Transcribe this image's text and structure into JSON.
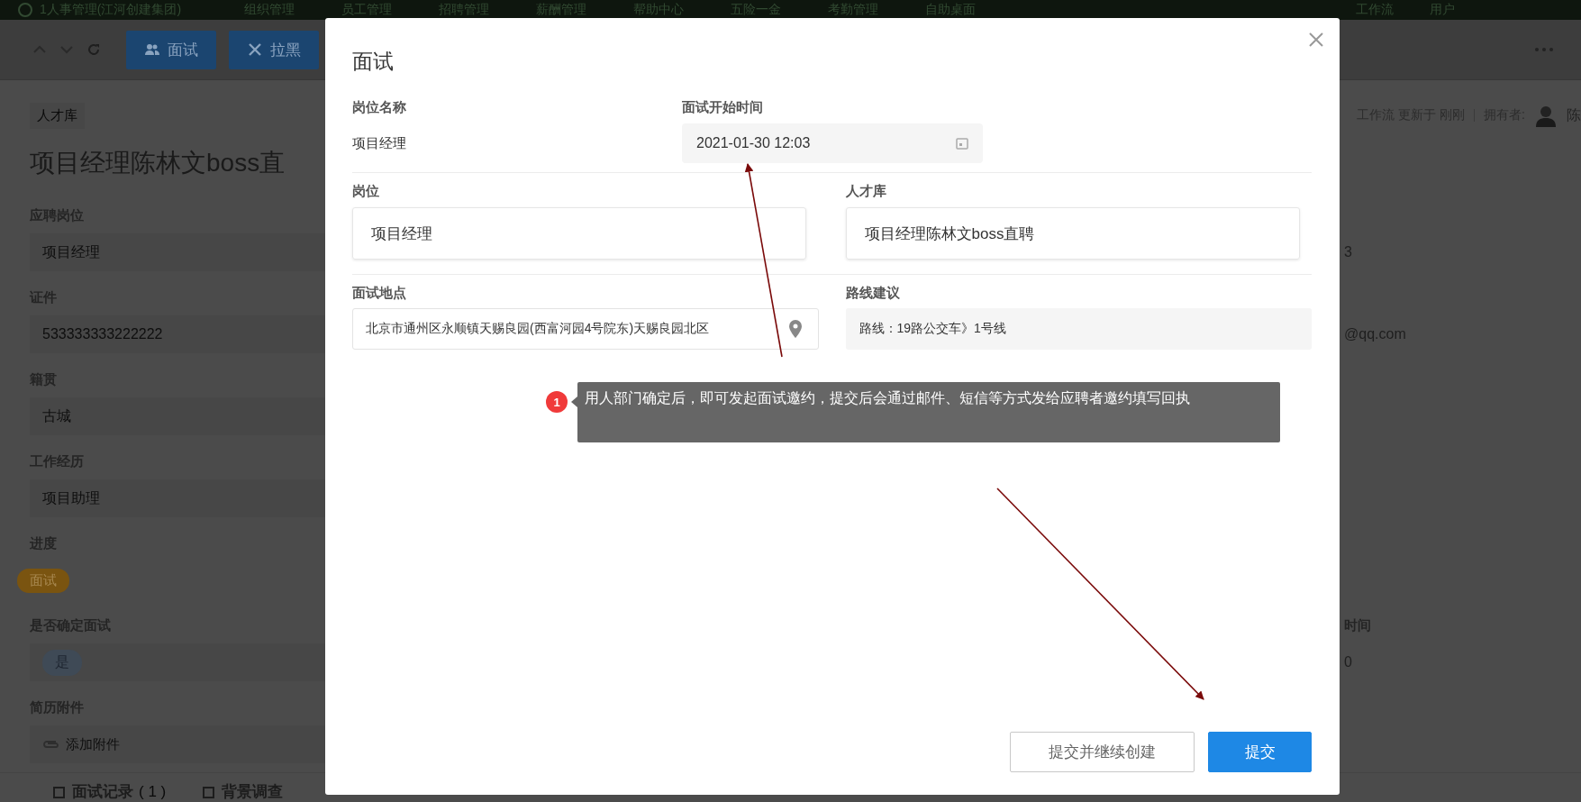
{
  "nav": {
    "company": "1人事管理(江河创建集团)",
    "items": [
      "组织管理",
      "员工管理",
      "招聘管理",
      "薪酬管理",
      "帮助中心",
      "五险一金",
      "考勤管理",
      "自助桌面"
    ],
    "right_items": [
      "工作流",
      "用户"
    ]
  },
  "toolbar": {
    "buttons": [
      {
        "label": "面试",
        "kind": "people"
      },
      {
        "label": "拉黑",
        "kind": "close"
      }
    ]
  },
  "page": {
    "breadcrumb": "人才库",
    "meta": [
      "工作流 更新于 刚刚",
      "拥有者:"
    ],
    "owner": "陈",
    "title": "项目经理陈林文boss直",
    "rows": [
      {
        "label": "应聘岗位",
        "kind": "text",
        "value": "项目经理",
        "right_value": "3"
      },
      {
        "label": "证件",
        "kind": "text",
        "value": "533333333222222",
        "right_value": "@qq.com"
      },
      {
        "label": "籍贯",
        "kind": "text",
        "value": "古城"
      },
      {
        "label": "工作经历",
        "kind": "text",
        "value": "项目助理"
      },
      {
        "label": "进度",
        "kind": "tag",
        "value": "面试"
      },
      {
        "label": "是否确定面试",
        "kind": "pill",
        "value": "是",
        "right_label": "时间",
        "right_value": "0"
      },
      {
        "label": "简历附件",
        "kind": "attachment",
        "value": "添加附件"
      }
    ],
    "tabs": [
      {
        "label": "面试记录",
        "count": "( 1 )"
      },
      {
        "label": "背景调查"
      }
    ]
  },
  "dialog": {
    "title": "面试",
    "job_name": {
      "label": "岗位名称",
      "value": "项目经理"
    },
    "start_time": {
      "label": "面试开始时间",
      "value": "2021-01-30 12:03"
    },
    "position": {
      "label": "岗位",
      "value": "项目经理"
    },
    "talent_pool": {
      "label": "人才库",
      "value": "项目经理陈林文boss直聘"
    },
    "location": {
      "label": "面试地点",
      "value": "北京市通州区永顺镇天赐良园(西富河园4号院东)天赐良园北区"
    },
    "route": {
      "label": "路线建议",
      "value": "路线：19路公交车》1号线"
    },
    "annotation": {
      "number": "1",
      "text": "用人部门确定后，即可发起面试邀约，提交后会通过邮件、短信等方式发给应聘者邀约填写回执"
    },
    "buttons": [
      {
        "label": "提交并继续创建",
        "kind": "secondary"
      },
      {
        "label": "提交",
        "kind": "primary"
      }
    ]
  }
}
